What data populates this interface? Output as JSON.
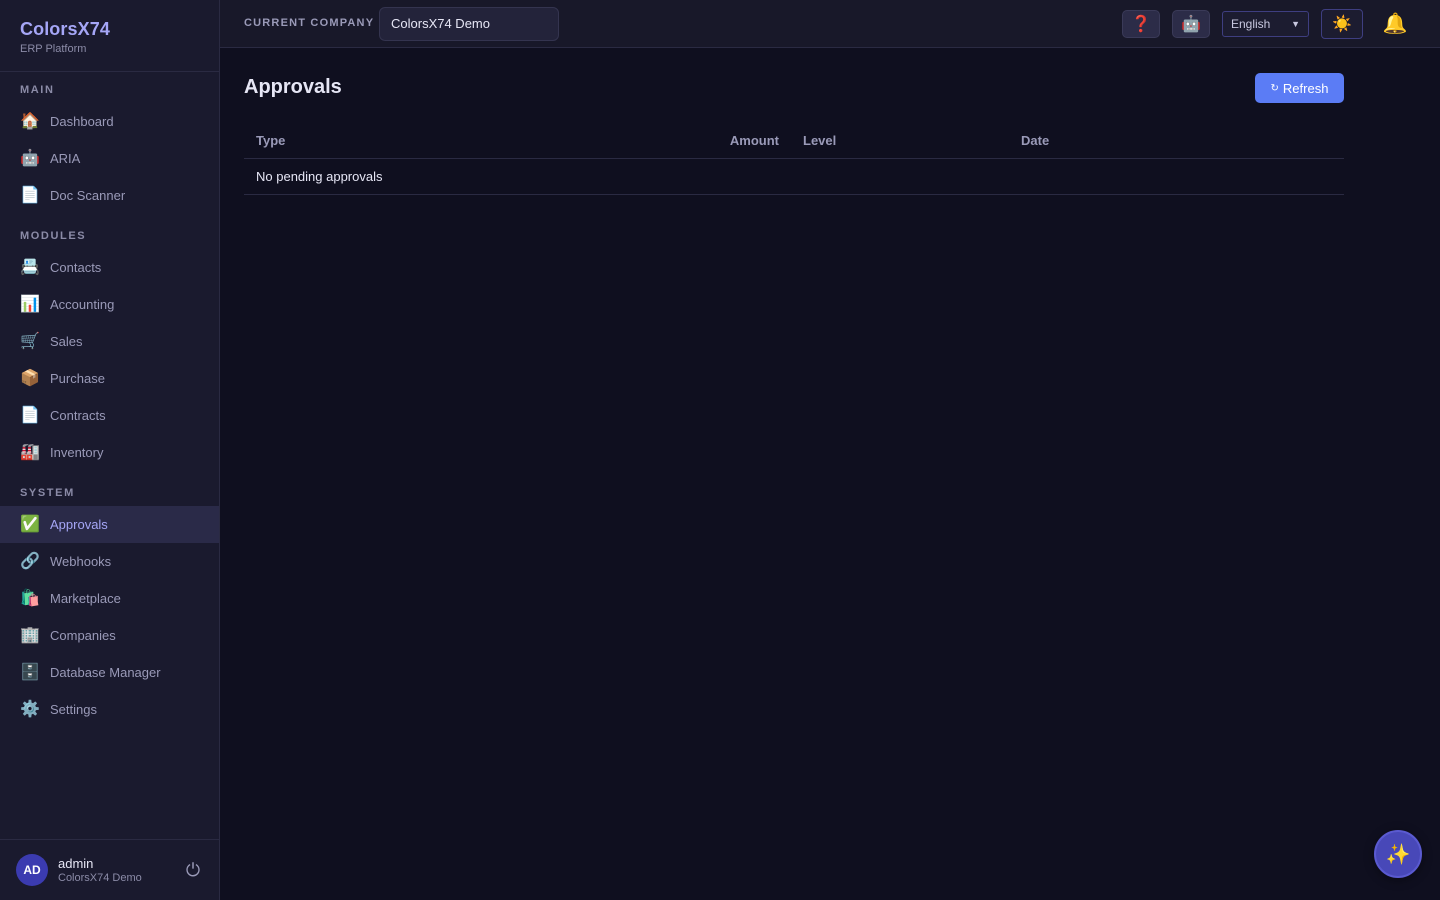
{
  "brand": {
    "title": "ColorsX74",
    "subtitle": "ERP Platform"
  },
  "sidebar": {
    "main": {
      "label": "MAIN",
      "items": [
        {
          "label": "Dashboard",
          "icon": "🏠"
        },
        {
          "label": "ARIA",
          "icon": "🤖"
        },
        {
          "label": "Doc Scanner",
          "icon": "📄"
        }
      ]
    },
    "modules": {
      "label": "MODULES",
      "items": [
        {
          "label": "Contacts",
          "icon": "📇"
        },
        {
          "label": "Accounting",
          "icon": "📊"
        },
        {
          "label": "Sales",
          "icon": "🛒"
        },
        {
          "label": "Purchase",
          "icon": "📦"
        },
        {
          "label": "Contracts",
          "icon": "📄"
        },
        {
          "label": "Inventory",
          "icon": "🏭"
        }
      ]
    },
    "system": {
      "label": "SYSTEM",
      "items": [
        {
          "label": "Approvals",
          "icon": "✅",
          "active": true
        },
        {
          "label": "Webhooks",
          "icon": "🔗"
        },
        {
          "label": "Marketplace",
          "icon": "🛍️"
        },
        {
          "label": "Companies",
          "icon": "🏢"
        },
        {
          "label": "Database Manager",
          "icon": "🗄️"
        },
        {
          "label": "Settings",
          "icon": "⚙️"
        }
      ]
    }
  },
  "user": {
    "initials": "AD",
    "name": "admin",
    "company": "ColorsX74 Demo",
    "logout_icon": "⏻"
  },
  "topbar": {
    "company_label": "CURRENT COMPANY",
    "company_value": "ColorsX74 Demo",
    "help_icon": "❓",
    "bot_icon": "🤖",
    "language": "English",
    "theme_icon": "☀️",
    "bell_icon": "🔔"
  },
  "main": {
    "title": "Approvals",
    "refresh_label": "Refresh",
    "refresh_icon": "↻",
    "table": {
      "headers": {
        "type": "Type",
        "amount": "Amount",
        "level": "Level",
        "date": "Date"
      },
      "empty_message": "No pending approvals"
    }
  },
  "fab": {
    "icon": "✨"
  },
  "colors": {
    "accent": "#5b7cf5",
    "brand": "#a5a6f6",
    "background": "#0f0f1f",
    "sidebar": "#1a1a2e"
  }
}
